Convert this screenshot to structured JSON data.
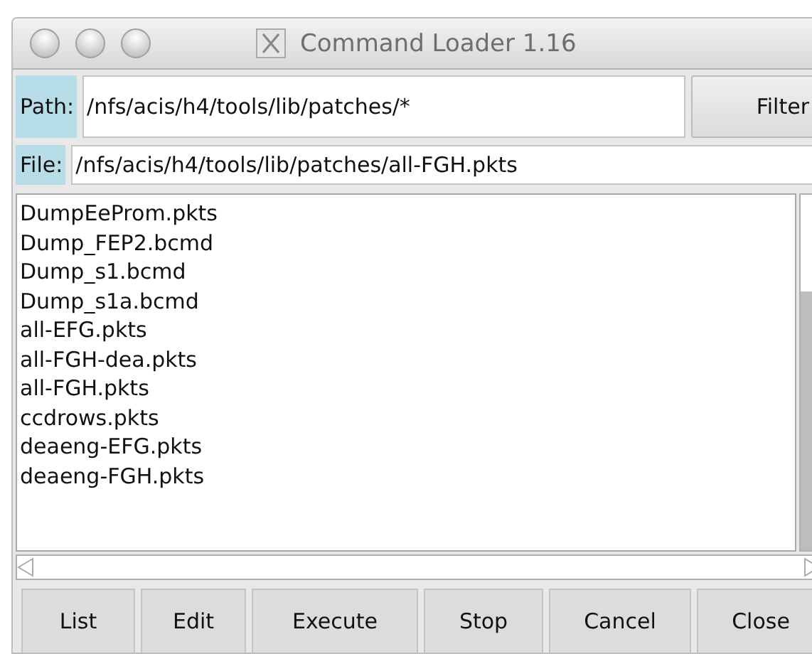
{
  "window": {
    "title": "Command Loader 1.16"
  },
  "path": {
    "label": "Path:",
    "value": "/nfs/acis/h4/tools/lib/patches/*",
    "button": "Filter"
  },
  "file": {
    "label": "File:",
    "value": "/nfs/acis/h4/tools/lib/patches/all-FGH.pkts"
  },
  "files": [
    "DumpEeProm.pkts",
    "Dump_FEP2.bcmd",
    "Dump_s1.bcmd",
    "Dump_s1a.bcmd",
    "all-EFG.pkts",
    "all-FGH-dea.pkts",
    "all-FGH.pkts",
    "ccdrows.pkts",
    "deaeng-EFG.pkts",
    "deaeng-FGH.pkts"
  ],
  "buttons": [
    "List",
    "Edit",
    "Execute",
    "Stop",
    "Cancel",
    "Close"
  ]
}
